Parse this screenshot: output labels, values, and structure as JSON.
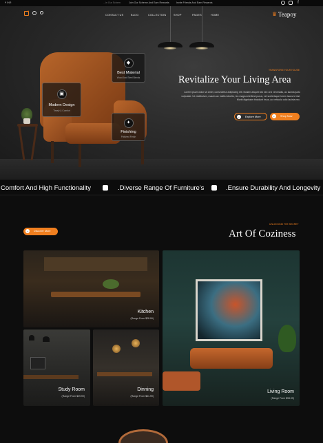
{
  "topbar": {
    "currency": "₹ INR",
    "left_promo": "...in Our Schem",
    "promo_1": "Join Our Scheme And Earn Rewards",
    "promo_2": "Invite Friends And Earn Rewards",
    "social_icons": [
      "whatsapp-icon",
      "instagram-icon",
      "facebook-icon"
    ]
  },
  "nav": {
    "items": [
      "CONTACT US",
      "BLOG",
      "COLLECTION",
      "SHOP",
      "PAGES",
      "HOME"
    ],
    "logo": "Teapoy",
    "cart_count": "0"
  },
  "hero": {
    "eyebrow": "TRANSFORM YOUR HOUSE",
    "title": "Revitalize Your Living Area",
    "paragraph": "Lorem ipsum dolor sit amet, consectetur adipiscing elit. Nullam aliquet nisi nec orci venenatis, ac lacinia justo vulputate. Ut vestibulum, mauris ac mollis lobortis, leo magna eleifend purus, vel scelerisque lorem lacus id nisl. Morbi dignissim tincidunt risus, ac vehicula odio lacinia nec.",
    "explore_button": "Explore More",
    "shop_button": "Shop Now",
    "features": [
      {
        "title": "Best Material",
        "subtitle": "Wood And Steel Blends"
      },
      {
        "title": "Modern Design",
        "subtitle": "Timely & Comfort"
      },
      {
        "title": "Finishing",
        "subtitle": "Polished Finish"
      }
    ]
  },
  "marquee": {
    "items": [
      "Comfort And High Functionality",
      ".Diverse Range Of Furniture's",
      ".Ensure Durability And Longevity"
    ]
  },
  "section": {
    "button": "Discover More",
    "eyebrow": "UNLOCKING THE SECRET",
    "title": "Art Of Coziness",
    "rooms": [
      {
        "name": "Kitchen",
        "range": "(Range From $28.99)"
      },
      {
        "name": "Study Room",
        "range": "(Range From $39.99)"
      },
      {
        "name": "Dinning",
        "range": "(Range From $61.99)"
      },
      {
        "name": "Living Room",
        "range": "(Range From $53.99)"
      }
    ]
  },
  "colors": {
    "accent": "#f07f1f",
    "leather": "#a0521f",
    "background": "#0d0d0d"
  }
}
